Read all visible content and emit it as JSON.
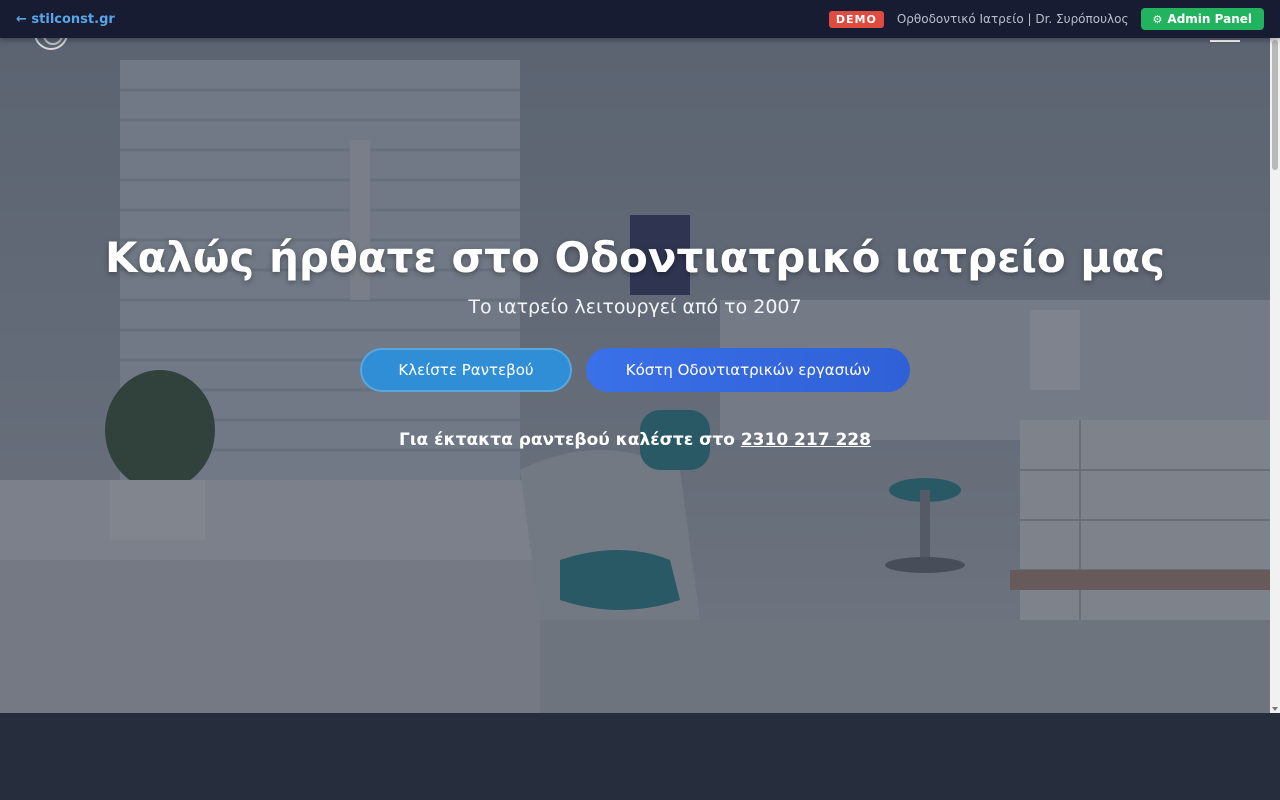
{
  "demo_bar": {
    "back_link": "← stilconst.gr",
    "badge": "DEMO",
    "site_caption": "Ορθοδοντικό Ιατρείο | Dr. Συρόπουλος",
    "admin_icon": "⚙",
    "admin_label": "Admin Panel"
  },
  "hero": {
    "title": "Καλώς ήρθατε στο Οδοντιατρικό ιατρείο μας",
    "subtitle": "Το ιατρείο λειτουργεί από το 2007",
    "primary_button": "Κλείστε Ραντεβού",
    "secondary_button": "Κόστη Οδοντιατρικών εργασιών",
    "emergency_text": "Για έκτακτα ραντεβού καλέστε στο",
    "phone": "2310 217 228"
  },
  "colors": {
    "top_bar": "#171c33",
    "link": "#58a6e8",
    "demo_badge": "#e04b3f",
    "admin_button": "#22b35e",
    "primary_button": "#2f8ed6",
    "secondary_button": "#3a70e8",
    "footer_bg": "#262d3c"
  }
}
